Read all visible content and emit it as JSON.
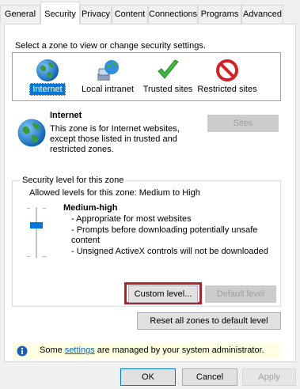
{
  "tabs": [
    {
      "label": "General"
    },
    {
      "label": "Security"
    },
    {
      "label": "Privacy"
    },
    {
      "label": "Content"
    },
    {
      "label": "Connections"
    },
    {
      "label": "Programs"
    },
    {
      "label": "Advanced"
    }
  ],
  "zones": {
    "prompt": "Select a zone to view or change security settings.",
    "items": [
      {
        "label": "Internet",
        "icon": "globe-icon"
      },
      {
        "label": "Local intranet",
        "icon": "network-globe-icon"
      },
      {
        "label": "Trusted sites",
        "icon": "checkmark-icon"
      },
      {
        "label": "Restricted sites",
        "icon": "prohibited-icon"
      }
    ],
    "selected_index": 0
  },
  "zone_detail": {
    "title": "Internet",
    "description_lines": [
      "This zone is for Internet websites,",
      "except those listed in trusted and",
      "restricted zones."
    ],
    "sites_button": "Sites"
  },
  "security_level": {
    "group_title": "Security level for this zone",
    "allowed": "Allowed levels for this zone: Medium to High",
    "level_name": "Medium-high",
    "bullets": [
      "- Appropriate for most websites",
      "- Prompts before downloading potentially unsafe",
      "content",
      "- Unsigned ActiveX controls will not be downloaded"
    ],
    "slider_level": 0.667,
    "custom_button": "Custom level...",
    "default_button": "Default level"
  },
  "reset_button": "Reset all zones to default level",
  "info": {
    "prefix": "Some ",
    "link": "settings",
    "suffix": " are managed by your system administrator."
  },
  "dialog_buttons": {
    "ok": "OK",
    "cancel": "Cancel",
    "apply": "Apply"
  },
  "colors": {
    "accent": "#0078d7",
    "highlight_border": "#b01e2f",
    "info_bg": "#ffffe1"
  }
}
